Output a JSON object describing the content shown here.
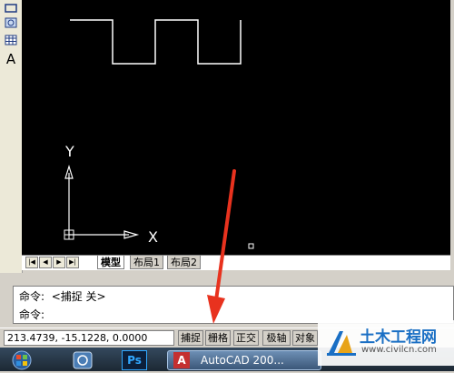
{
  "tabs": [
    {
      "label": "模型",
      "active": true
    },
    {
      "label": "布局1",
      "active": false
    },
    {
      "label": "布局2",
      "active": false
    }
  ],
  "nav_buttons": [
    "|◀",
    "◀",
    "▶",
    "▶|"
  ],
  "axes": {
    "y_label": "Y",
    "x_label": "X"
  },
  "command": {
    "line1_prompt": "命令:",
    "line1_text": "<捕捉 关>",
    "line2_prompt": "命令:"
  },
  "status": {
    "coordinates": "213.4739, -15.1228, 0.0000",
    "buttons": [
      "捕捉",
      "栅格",
      "正交",
      "极轴",
      "对象"
    ]
  },
  "taskbar": {
    "autocad_label": "AutoCAD 200...",
    "ps_label": "Ps"
  },
  "watermark": {
    "title": "土木工程网",
    "url": "www.civilcn.com"
  },
  "colors": {
    "canvas": "#000000",
    "arrow": "#e8321e",
    "accent": "#1a6fc4"
  }
}
